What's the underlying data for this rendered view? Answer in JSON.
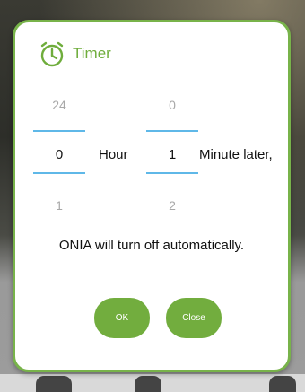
{
  "dialog": {
    "title": "Timer",
    "icon": "stopwatch-icon",
    "accent_color": "#78b34a"
  },
  "hour_picker": {
    "previous": "24",
    "current": "0",
    "next": "1",
    "unit_label": "Hour"
  },
  "minute_picker": {
    "previous": "0",
    "current": "1",
    "next": "2",
    "unit_label": "Minute later,"
  },
  "message": "ONIA will turn off automatically.",
  "buttons": {
    "ok_label": "OK",
    "close_label": "Close"
  }
}
